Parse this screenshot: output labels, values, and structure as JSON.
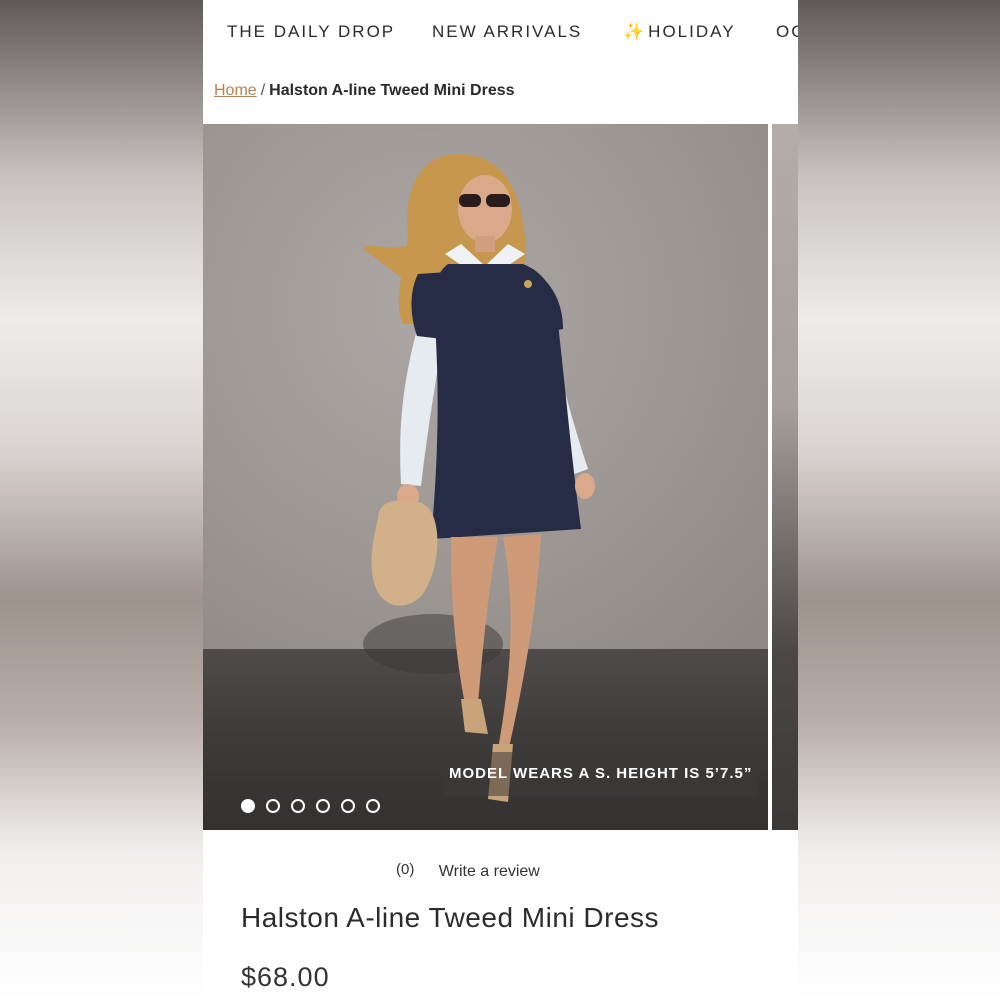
{
  "nav": {
    "items": [
      "THE DAILY DROP",
      "NEW ARRIVALS",
      "HOLIDAY",
      "OC"
    ],
    "holiday_icon": "✨"
  },
  "breadcrumb": {
    "home": "Home",
    "separator": "/",
    "current": "Halston A-line Tweed Mini Dress"
  },
  "gallery": {
    "caption": "MODEL WEARS A S. HEIGHT IS 5’7.5”",
    "slide_count": 6,
    "active_slide": 1
  },
  "reviews": {
    "count": "(0)",
    "write_label": "Write a review"
  },
  "product": {
    "title": "Halston A-line Tweed Mini Dress",
    "price": "$68.00"
  },
  "colors": {
    "accent_link": "#b98052",
    "text": "#2c2c2c"
  }
}
